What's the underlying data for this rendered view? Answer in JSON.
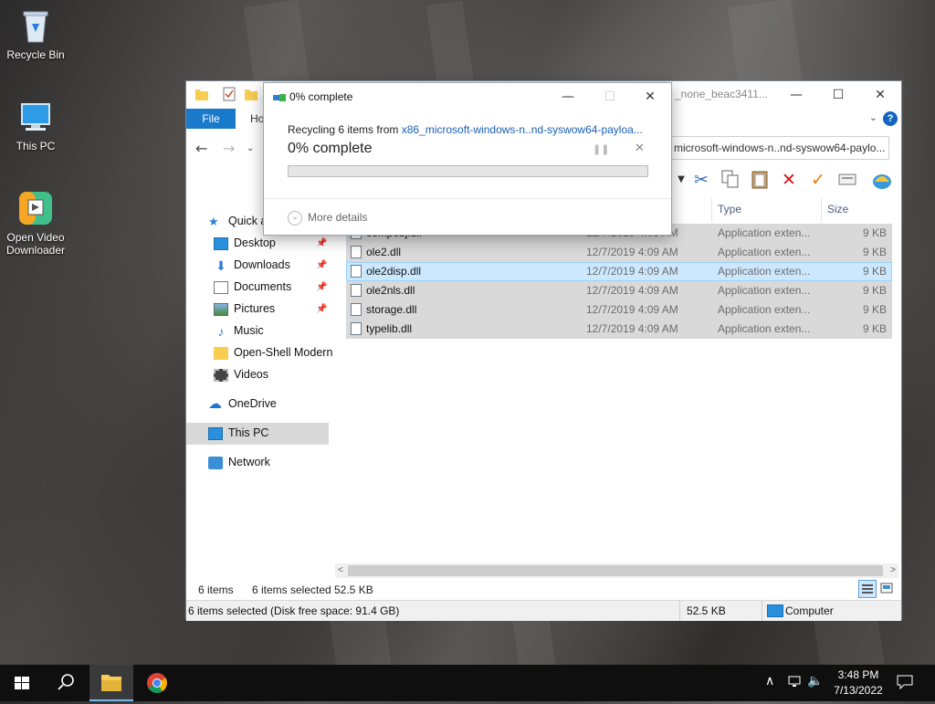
{
  "desktop": {
    "icons": [
      {
        "label": "Recycle Bin",
        "icon": "recycle-bin-icon"
      },
      {
        "label": "This PC",
        "icon": "computer-icon"
      },
      {
        "label": "Open Video Downloader",
        "icon": "video-downloader-icon"
      }
    ]
  },
  "explorer": {
    "title": "_none_beac3411...",
    "ribbon": {
      "file_tab": "File",
      "home_tab": "Ho"
    },
    "address": "microsoft-windows-n..nd-syswow64-paylo...",
    "nav": [
      {
        "label": "Quick a",
        "icon": "star-icon"
      },
      {
        "label": "Desktop",
        "icon": "desktop-icon",
        "pinned": true
      },
      {
        "label": "Downloads",
        "icon": "download-icon",
        "pinned": true
      },
      {
        "label": "Documents",
        "icon": "documents-icon",
        "pinned": true
      },
      {
        "label": "Pictures",
        "icon": "pictures-icon",
        "pinned": true
      },
      {
        "label": "Music",
        "icon": "music-icon"
      },
      {
        "label": "Open-Shell Modern",
        "icon": "folder-icon"
      },
      {
        "label": "Videos",
        "icon": "videos-icon"
      },
      {
        "label": "OneDrive",
        "icon": "cloud-icon"
      },
      {
        "label": "This PC",
        "icon": "computer-icon"
      },
      {
        "label": "Network",
        "icon": "network-icon"
      }
    ],
    "columns": {
      "type": "Type",
      "size": "Size"
    },
    "files": [
      {
        "name": "compobj.dll",
        "date": "12/7/2019 4:09 AM",
        "type": "Application exten...",
        "size": "9 KB"
      },
      {
        "name": "ole2.dll",
        "date": "12/7/2019 4:09 AM",
        "type": "Application exten...",
        "size": "9 KB"
      },
      {
        "name": "ole2disp.dll",
        "date": "12/7/2019 4:09 AM",
        "type": "Application exten...",
        "size": "9 KB"
      },
      {
        "name": "ole2nls.dll",
        "date": "12/7/2019 4:09 AM",
        "type": "Application exten...",
        "size": "9 KB"
      },
      {
        "name": "storage.dll",
        "date": "12/7/2019 4:09 AM",
        "type": "Application exten...",
        "size": "9 KB"
      },
      {
        "name": "typelib.dll",
        "date": "12/7/2019 4:09 AM",
        "type": "Application exten...",
        "size": "9 KB"
      }
    ],
    "status": {
      "items": "6 items",
      "selected": "6 items selected",
      "selected_size": "52.5 KB",
      "detail_left": "6 items selected (Disk free space: 91.4 GB)",
      "detail_size": "52.5 KB",
      "detail_location": "Computer"
    }
  },
  "progress_dialog": {
    "title": "0% complete",
    "recycling_prefix": "Recycling 6 items from ",
    "recycling_source": "x86_microsoft-windows-n..nd-syswow64-payloa...",
    "percent_text": "0% complete",
    "progress_fraction": 0,
    "more_details": "More details"
  },
  "taskbar": {
    "time": "3:48 PM",
    "date": "7/13/2022"
  },
  "colors": {
    "accent": "#1979ca",
    "selection": "#cce8ff",
    "progress": "#06b025"
  }
}
